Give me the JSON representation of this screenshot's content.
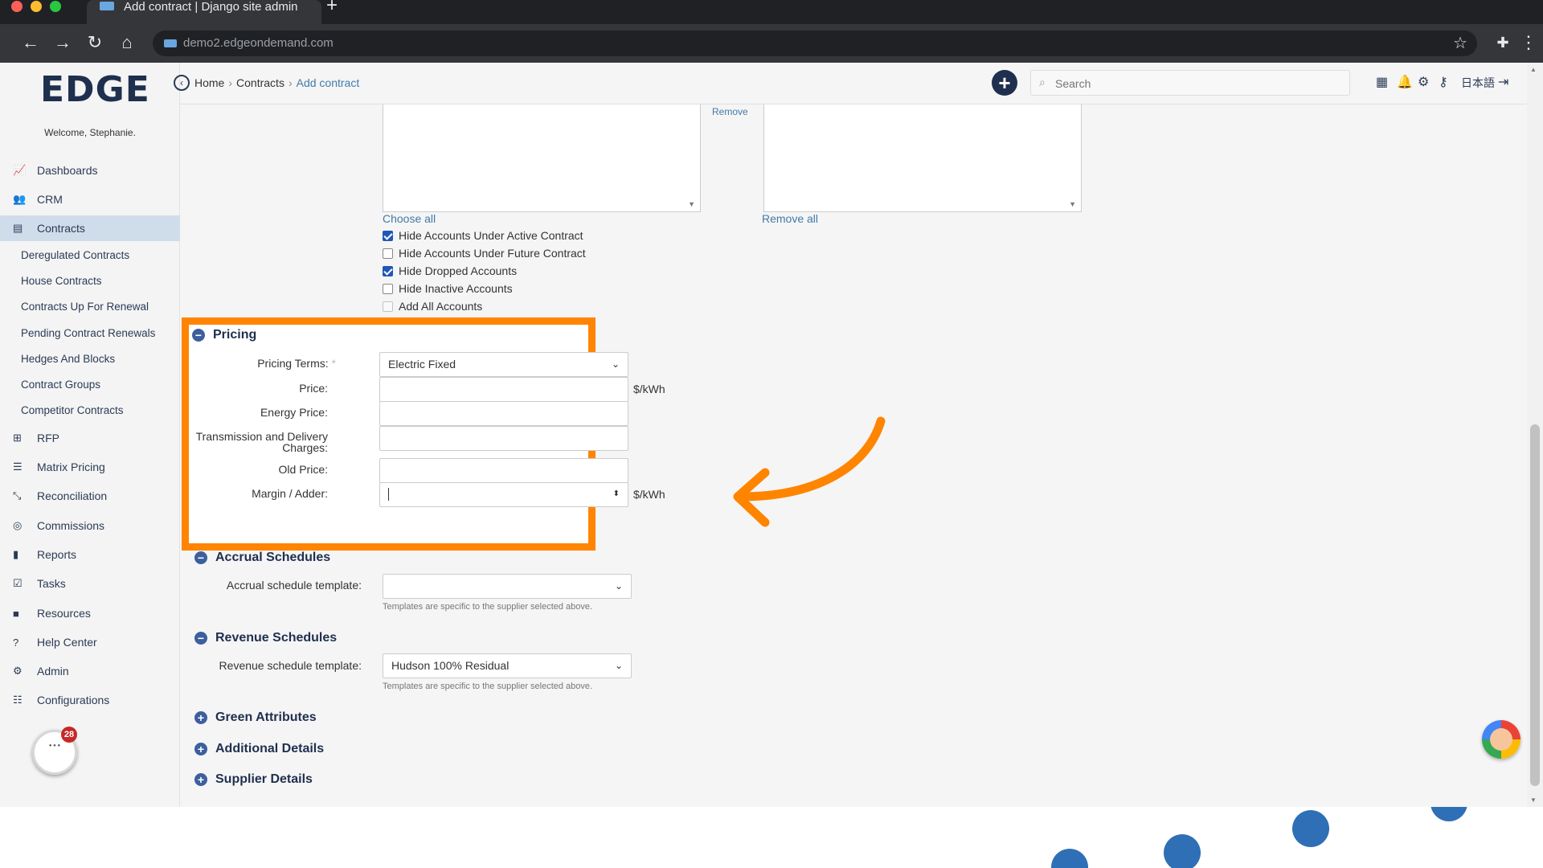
{
  "browser": {
    "tab_title": "Add contract | Django site admin",
    "new_tab": "+",
    "url": "demo2.edgeondemand.com"
  },
  "sidebar": {
    "logo": "EDGE",
    "welcome": "Welcome, Stephanie.",
    "items": [
      {
        "label": "Dashboards",
        "icon": "chart-line-icon"
      },
      {
        "label": "CRM",
        "icon": "users-icon"
      },
      {
        "label": "Contracts",
        "icon": "document-icon"
      },
      {
        "label": "RFP",
        "icon": "sitemap-icon"
      },
      {
        "label": "Matrix Pricing",
        "icon": "list-icon"
      },
      {
        "label": "Reconciliation",
        "icon": "compress-icon"
      },
      {
        "label": "Commissions",
        "icon": "coins-icon"
      },
      {
        "label": "Reports",
        "icon": "bar-chart-icon"
      },
      {
        "label": "Tasks",
        "icon": "calendar-check-icon"
      },
      {
        "label": "Resources",
        "icon": "folder-icon"
      },
      {
        "label": "Help Center",
        "icon": "question-icon"
      },
      {
        "label": "Admin",
        "icon": "cogs-icon"
      },
      {
        "label": "Configurations",
        "icon": "sliders-icon"
      }
    ],
    "sub_items": [
      "Deregulated Contracts",
      "House Contracts",
      "Contracts Up For Renewal",
      "Pending Contract Renewals",
      "Hedges And Blocks",
      "Contract Groups",
      "Competitor Contracts"
    ],
    "badge_count": "28"
  },
  "header": {
    "breadcrumb": {
      "home": "Home",
      "sep": "›",
      "section": "Contracts",
      "current": "Add contract"
    },
    "search_placeholder": "Search",
    "lang": "日本語"
  },
  "accounts": {
    "remove_label": "Remove",
    "choose_all": "Choose all",
    "remove_all": "Remove all",
    "checkboxes": [
      {
        "label": "Hide Accounts Under Active Contract",
        "checked": true
      },
      {
        "label": "Hide Accounts Under Future Contract",
        "checked": false
      },
      {
        "label": "Hide Dropped Accounts",
        "checked": true
      },
      {
        "label": "Hide Inactive Accounts",
        "checked": false
      },
      {
        "label": "Add All Accounts",
        "checked": false
      }
    ]
  },
  "pricing": {
    "title": "Pricing",
    "pricing_terms_label": "Pricing Terms:",
    "pricing_terms_value": "Electric Fixed",
    "price_label": "Price:",
    "price_unit": "$/kWh",
    "energy_price_label": "Energy Price:",
    "tdc_label_1": "Transmission and Delivery",
    "tdc_label_2": "Charges:",
    "old_price_label": "Old Price:",
    "margin_label": "Margin / Adder:",
    "margin_unit": "$/kWh"
  },
  "accrual": {
    "title": "Accrual Schedules",
    "template_label": "Accrual schedule template:",
    "template_value": "",
    "help": "Templates are specific to the supplier selected above."
  },
  "revenue": {
    "title": "Revenue Schedules",
    "template_label": "Revenue schedule template:",
    "template_value": "Hudson 100% Residual",
    "help": "Templates are specific to the supplier selected above."
  },
  "collapsed_sections": [
    "Green Attributes",
    "Additional Details",
    "Supplier Details"
  ],
  "colors": {
    "highlight": "#ff8400",
    "accent": "#1f2f4e",
    "link": "#417aa9",
    "footer_dots": "#2f6fb5"
  }
}
